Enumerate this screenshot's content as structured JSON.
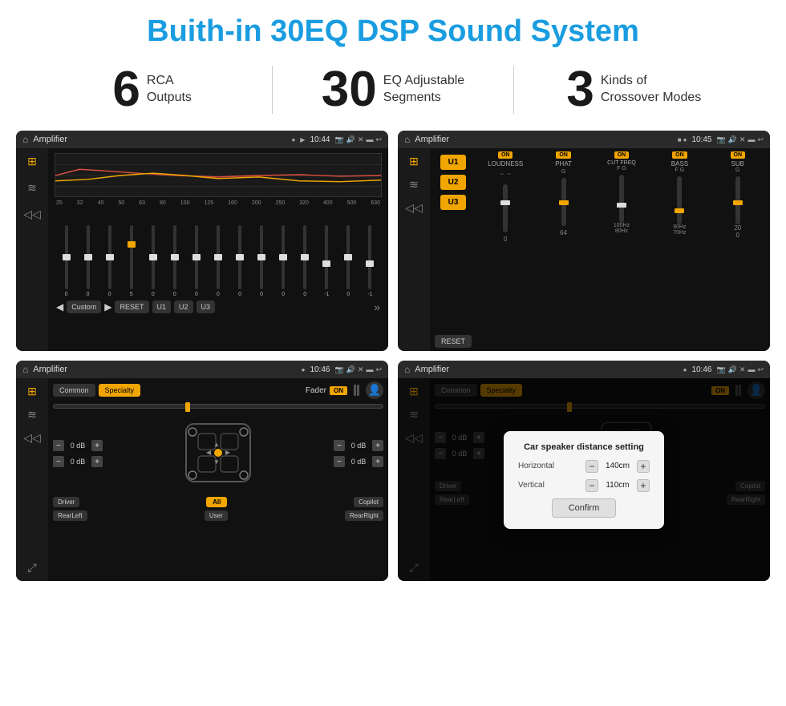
{
  "page": {
    "title": "Buith-in 30EQ DSP Sound System",
    "stats": [
      {
        "number": "6",
        "text": "RCA\nOutputs"
      },
      {
        "number": "30",
        "text": "EQ Adjustable\nSegments"
      },
      {
        "number": "3",
        "text": "Kinds of\nCrossover Modes"
      }
    ]
  },
  "screen1": {
    "status_bar": {
      "title": "Amplifier",
      "time": "10:44"
    },
    "freq_labels": [
      "25",
      "32",
      "40",
      "50",
      "63",
      "80",
      "100",
      "125",
      "160",
      "200",
      "250",
      "320",
      "400",
      "500",
      "630"
    ],
    "slider_values": [
      "0",
      "0",
      "0",
      "5",
      "0",
      "0",
      "0",
      "0",
      "0",
      "0",
      "0",
      "0",
      "-1",
      "0",
      "-1"
    ],
    "buttons": [
      "Custom",
      "RESET",
      "U1",
      "U2",
      "U3"
    ]
  },
  "screen2": {
    "status_bar": {
      "title": "Amplifier",
      "time": "10:45"
    },
    "u_buttons": [
      "U1",
      "U2",
      "U3"
    ],
    "modules": [
      "LOUDNESS",
      "PHAT",
      "CUT FREQ",
      "BASS",
      "SUB"
    ],
    "on_label": "ON",
    "reset_label": "RESET"
  },
  "screen3": {
    "status_bar": {
      "title": "Amplifier",
      "time": "10:46"
    },
    "tabs": [
      "Common",
      "Specialty"
    ],
    "fader_label": "Fader",
    "on_label": "ON",
    "db_values": [
      "0 dB",
      "0 dB",
      "0 dB",
      "0 dB"
    ],
    "location_buttons": [
      "Driver",
      "Copilot",
      "RearLeft",
      "RearRight"
    ],
    "all_button": "All",
    "user_button": "User"
  },
  "screen4": {
    "status_bar": {
      "title": "Amplifier",
      "time": "10:46"
    },
    "tabs": [
      "Common",
      "Specialty"
    ],
    "on_label": "ON",
    "dialog": {
      "title": "Car speaker distance setting",
      "horizontal_label": "Horizontal",
      "horizontal_value": "140cm",
      "vertical_label": "Vertical",
      "vertical_value": "110cm",
      "confirm_label": "Confirm"
    },
    "db_values": [
      "0 dB",
      "0 dB"
    ],
    "location_buttons": [
      "Driver",
      "Copilot",
      "RearLeft",
      "RearRight"
    ]
  },
  "icons": {
    "home": "⌂",
    "music": "♪",
    "wave": "≋",
    "volume": "◁",
    "speaker": "▣",
    "settings": "⚙",
    "arrow_left": "◀",
    "arrow_right": "▶",
    "arrow_more": "»",
    "gps": "📍",
    "camera": "📷",
    "phone": "📞",
    "back": "↩",
    "menu": "☰",
    "star": "★",
    "dot": "●",
    "eq_icon": "⊞",
    "filter_icon": "⊟",
    "expand": "⤢",
    "profile": "👤"
  }
}
